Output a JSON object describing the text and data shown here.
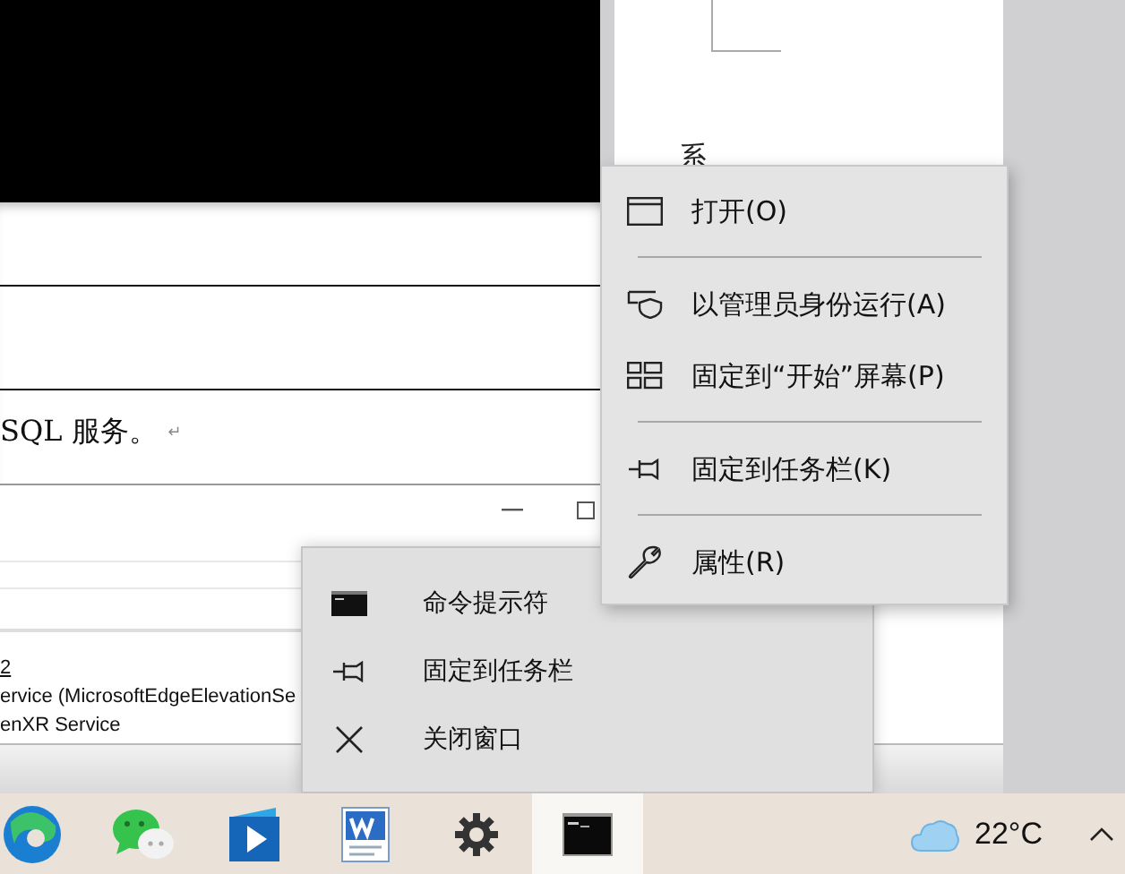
{
  "document": {
    "fragment": "系",
    "sentence": "SQL 服务。",
    "paragraph_mark": "↵"
  },
  "services_window": {
    "lines": [
      "2",
      "ervice (MicrosoftEdgeElevationSe",
      "enXR Service"
    ]
  },
  "context_menu": {
    "items": [
      {
        "kind": "open",
        "label": "打开(O)"
      },
      {
        "kind": "separator"
      },
      {
        "kind": "admin",
        "label": "以管理员身份运行(A)"
      },
      {
        "kind": "tiles",
        "label": "固定到“开始”屏幕(P)"
      },
      {
        "kind": "separator"
      },
      {
        "kind": "pin",
        "label": "固定到任务栏(K)"
      },
      {
        "kind": "separator"
      },
      {
        "kind": "properties",
        "label": "属性(R)"
      }
    ]
  },
  "jump_list": {
    "items": [
      {
        "kind": "app",
        "label": "命令提示符"
      },
      {
        "kind": "pin",
        "label": "固定到任务栏"
      },
      {
        "kind": "close",
        "label": "关闭窗口"
      }
    ]
  },
  "taskbar": {
    "apps": [
      {
        "kind": "edge",
        "active": false
      },
      {
        "kind": "chat",
        "active": false
      },
      {
        "kind": "video",
        "active": false
      },
      {
        "kind": "word",
        "active": false
      },
      {
        "kind": "settings",
        "active": false
      },
      {
        "kind": "terminal",
        "active": true
      }
    ],
    "weather": {
      "temperature": "22°C"
    }
  }
}
